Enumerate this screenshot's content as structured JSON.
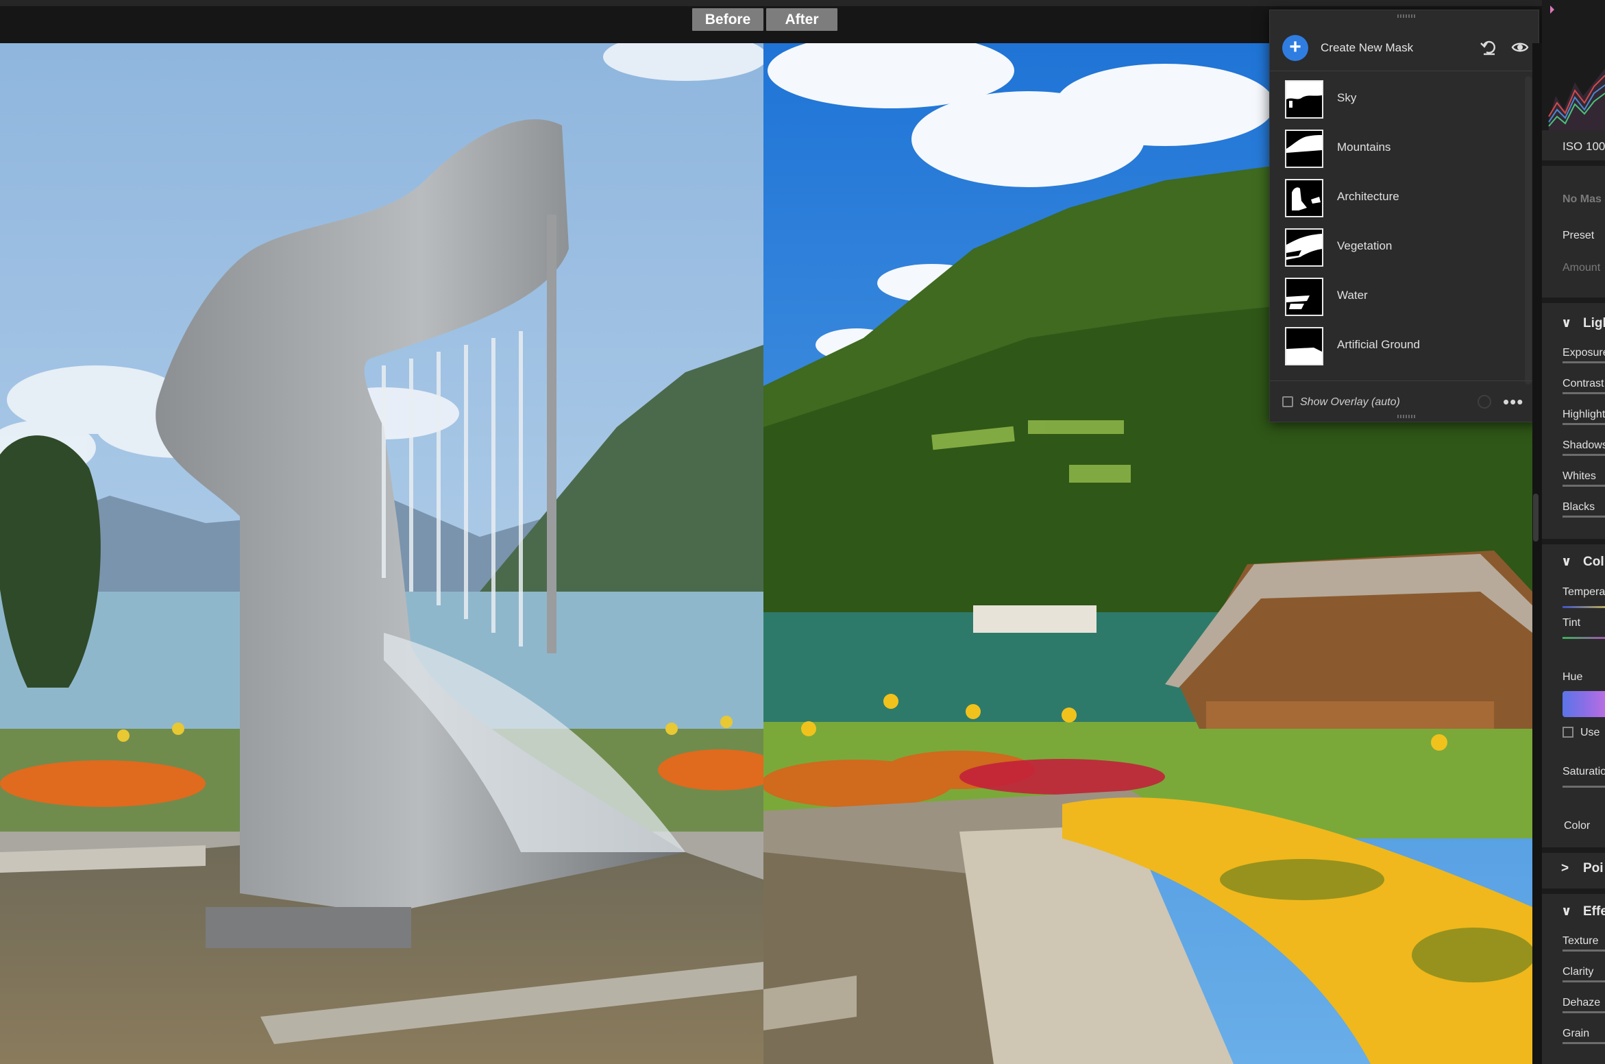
{
  "toolbar": {
    "before_label": "Before",
    "after_label": "After"
  },
  "mask_panel": {
    "create_label": "Create New Mask",
    "masks": [
      {
        "label": "Sky"
      },
      {
        "label": "Mountains"
      },
      {
        "label": "Architecture"
      },
      {
        "label": "Vegetation"
      },
      {
        "label": "Water"
      },
      {
        "label": "Artificial Ground"
      }
    ],
    "show_overlay_label": "Show Overlay (auto)",
    "show_overlay_checked": false,
    "accent_color": "#2f7de1"
  },
  "right_panel": {
    "iso": "ISO 100",
    "no_mask": "No Mas",
    "preset": "Preset",
    "amount": "Amount",
    "light_section": "Ligl",
    "light_items": [
      "Exposure",
      "Contrast",
      "Highlight",
      "Shadows",
      "Whites",
      "Blacks"
    ],
    "color_section": "Col",
    "temperature": "Tempera",
    "tint": "Tint",
    "hue": "Hue",
    "use_label": "Use",
    "saturation": "Saturatio",
    "color": "Color",
    "point_section": "Poi",
    "effects_section": "Effe",
    "effects_items": [
      "Texture",
      "Clarity",
      "Dehaze",
      "Grain"
    ]
  }
}
